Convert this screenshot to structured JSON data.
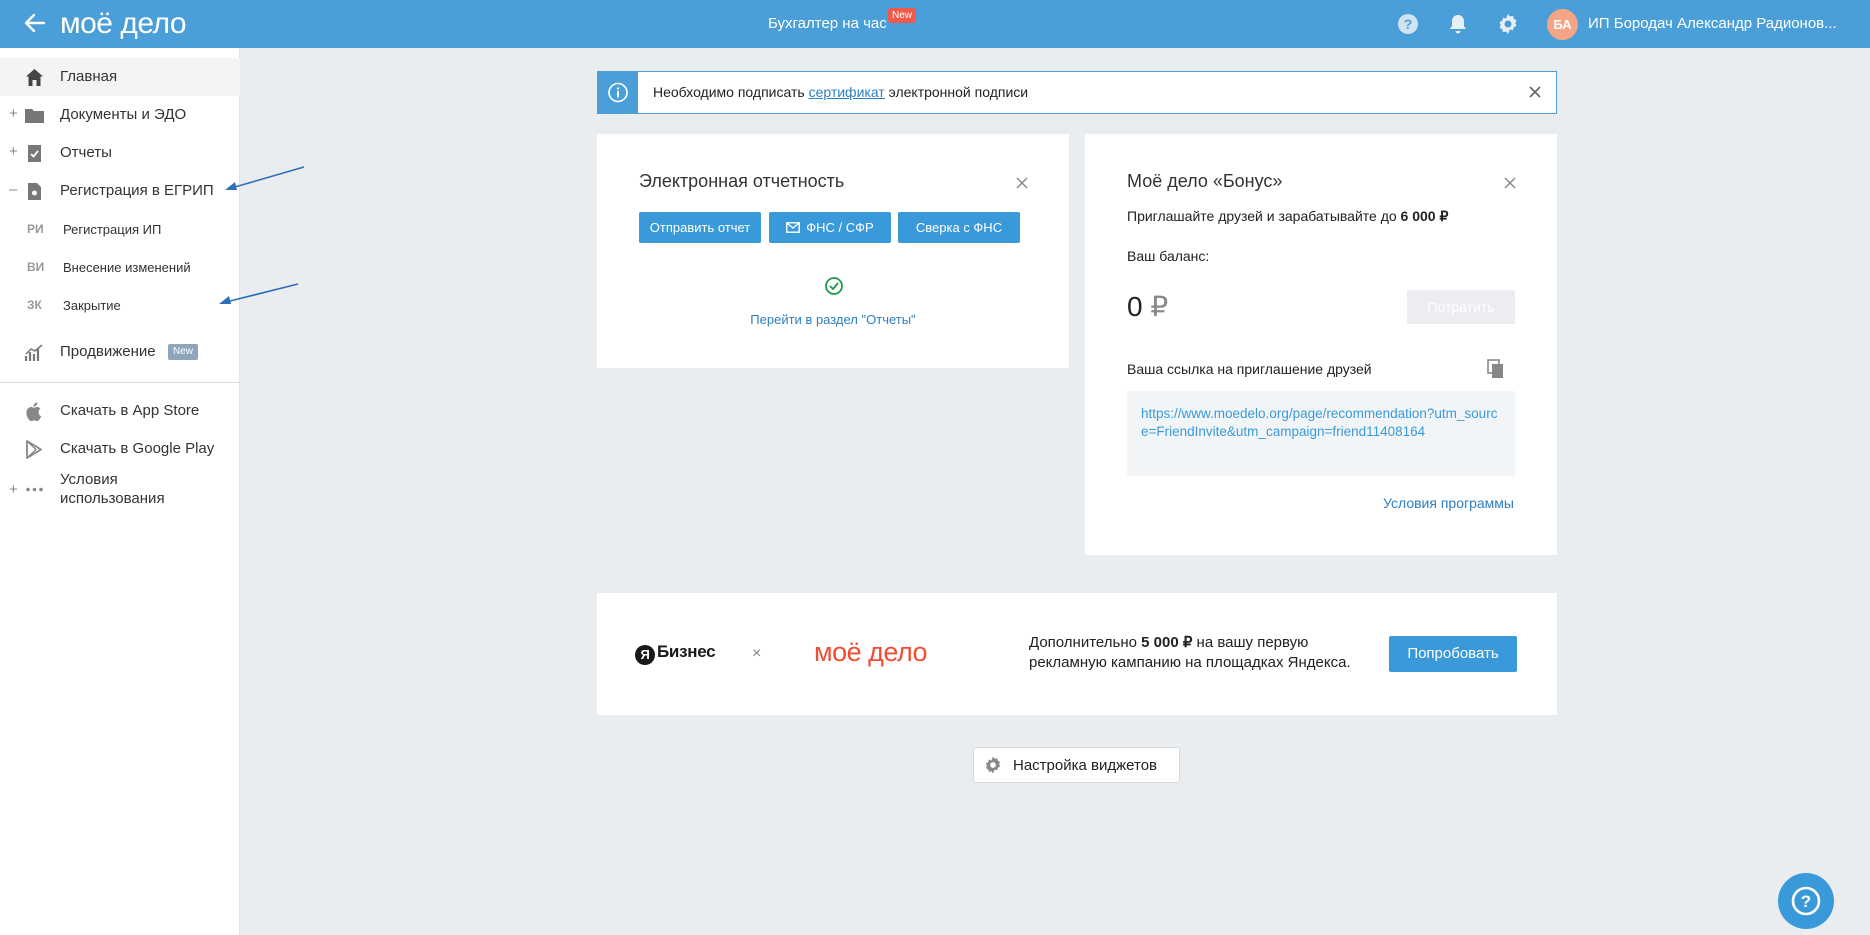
{
  "header": {
    "logo": "моё дело",
    "center_title": "Бухгалтер на час",
    "center_badge": "New",
    "avatar_initials": "БА",
    "user_name": "ИП Бородач Александр Радионов..."
  },
  "sidebar": {
    "items": [
      {
        "label": "Главная",
        "icon": "home-icon"
      },
      {
        "label": "Документы и ЭДО",
        "icon": "folder-icon",
        "expander": "+"
      },
      {
        "label": "Отчеты",
        "icon": "report-icon",
        "expander": "+"
      },
      {
        "label": "Регистрация в ЕГРИП",
        "icon": "registration-icon",
        "expander": "–"
      },
      {
        "label": "Продвижение",
        "icon": "chart-icon",
        "badge": "New"
      },
      {
        "label": "Скачать в App Store",
        "icon": "apple-icon"
      },
      {
        "label": "Скачать в Google Play",
        "icon": "google-play-icon"
      },
      {
        "label": "Условия использования",
        "label_line1": "Условия",
        "label_line2": "использования",
        "icon": "more-icon",
        "expander": "+"
      }
    ],
    "sub_items": [
      {
        "abbr": "РИ",
        "label": "Регистрация ИП"
      },
      {
        "abbr": "ВИ",
        "label": "Внесение изменений"
      },
      {
        "abbr": "ЗК",
        "label": "Закрытие"
      }
    ]
  },
  "notice": {
    "text_before": "Необходимо подписать ",
    "link": "сертификат",
    "text_after": " электронной подписи"
  },
  "reporting_card": {
    "title": "Электронная отчетность",
    "buttons": [
      "Отправить отчет",
      "ФНС / СФР",
      "Сверка с ФНС"
    ],
    "link": "Перейти в раздел \"Отчеты\""
  },
  "bonus_card": {
    "title": "Моё дело «Бонус»",
    "subtitle_prefix": "Приглашайте друзей и зарабатывайте до ",
    "subtitle_amount": "6 000 ₽",
    "balance_label": "Ваш баланс:",
    "balance_value": "0",
    "balance_currency": "₽",
    "spend_button": "Потратить",
    "invite_label": "Ваша ссылка на приглашение друзей",
    "invite_link": "https://www.moedelo.org/page/recommendation?utm_source=FriendInvite&utm_campaign=friend11408164",
    "terms_link": "Условия программы"
  },
  "promo": {
    "ya_letter": "Я",
    "partner_name": "Бизнес",
    "cross": "×",
    "brand": "моё дело",
    "text_prefix": "Дополнительно ",
    "text_amount": "5 000 ₽",
    "text_line1_suffix": " на вашу первую",
    "text_line2": "рекламную кампанию на площадках Яндекса.",
    "button": "Попробовать"
  },
  "widgets_button": "Настройка виджетов",
  "colors": {
    "brand_blue": "#4a9fd8",
    "button_blue": "#3a9ad9",
    "accent_red": "#f05a4a",
    "promo_orange": "#f04d33"
  }
}
